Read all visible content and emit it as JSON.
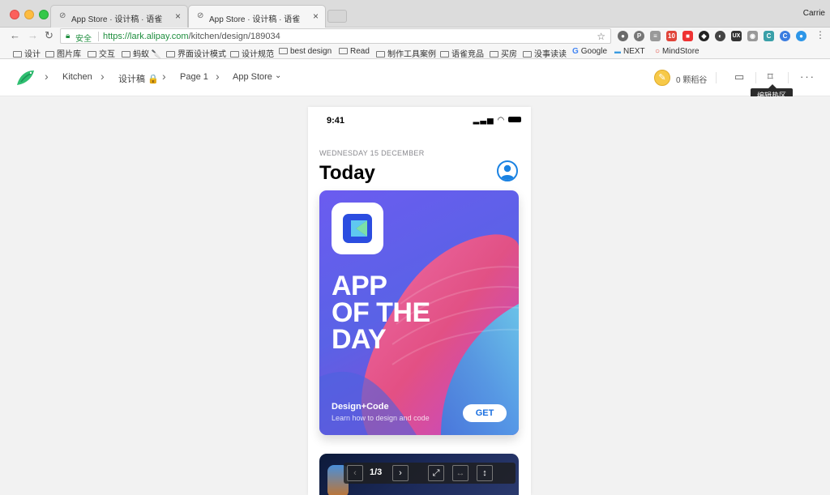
{
  "browser": {
    "profile": "Carrie",
    "tabs": [
      {
        "label": "App Store · 设计稿 · 语雀",
        "close": "×"
      },
      {
        "label": "App Store · 设计稿 · 语雀",
        "close": "×"
      }
    ],
    "address": {
      "secure_label": "安全",
      "url_host": "https://lark.alipay.com",
      "url_path": "/kitchen/design/189034"
    },
    "bookmarks": [
      "设计",
      "图片库",
      "交互",
      "蚂蚁 🔪",
      "界面设计模式",
      "设计规范",
      "best design",
      "Read",
      "制作工具案例",
      "语雀竞品",
      "买房",
      "没事读读",
      "Google",
      "NEXT",
      "MindStore"
    ]
  },
  "app_header": {
    "breadcrumb": [
      "Kitchen",
      "设计稿 🔒",
      "Page 1",
      "App Store"
    ],
    "coin_label": "0 颗稻谷",
    "tooltip": "编辑热区"
  },
  "phone": {
    "status_time": "9:41",
    "date_label": "WEDNESDAY 15 DECEMBER",
    "title": "Today",
    "card": {
      "headline_lines": [
        "APP",
        "OF THE",
        "DAY"
      ],
      "title": "Design+Code",
      "subtitle": "Learn how to design and code",
      "cta": "GET"
    }
  },
  "pager": {
    "count": "1/3",
    "prev": "‹",
    "next": "›"
  }
}
